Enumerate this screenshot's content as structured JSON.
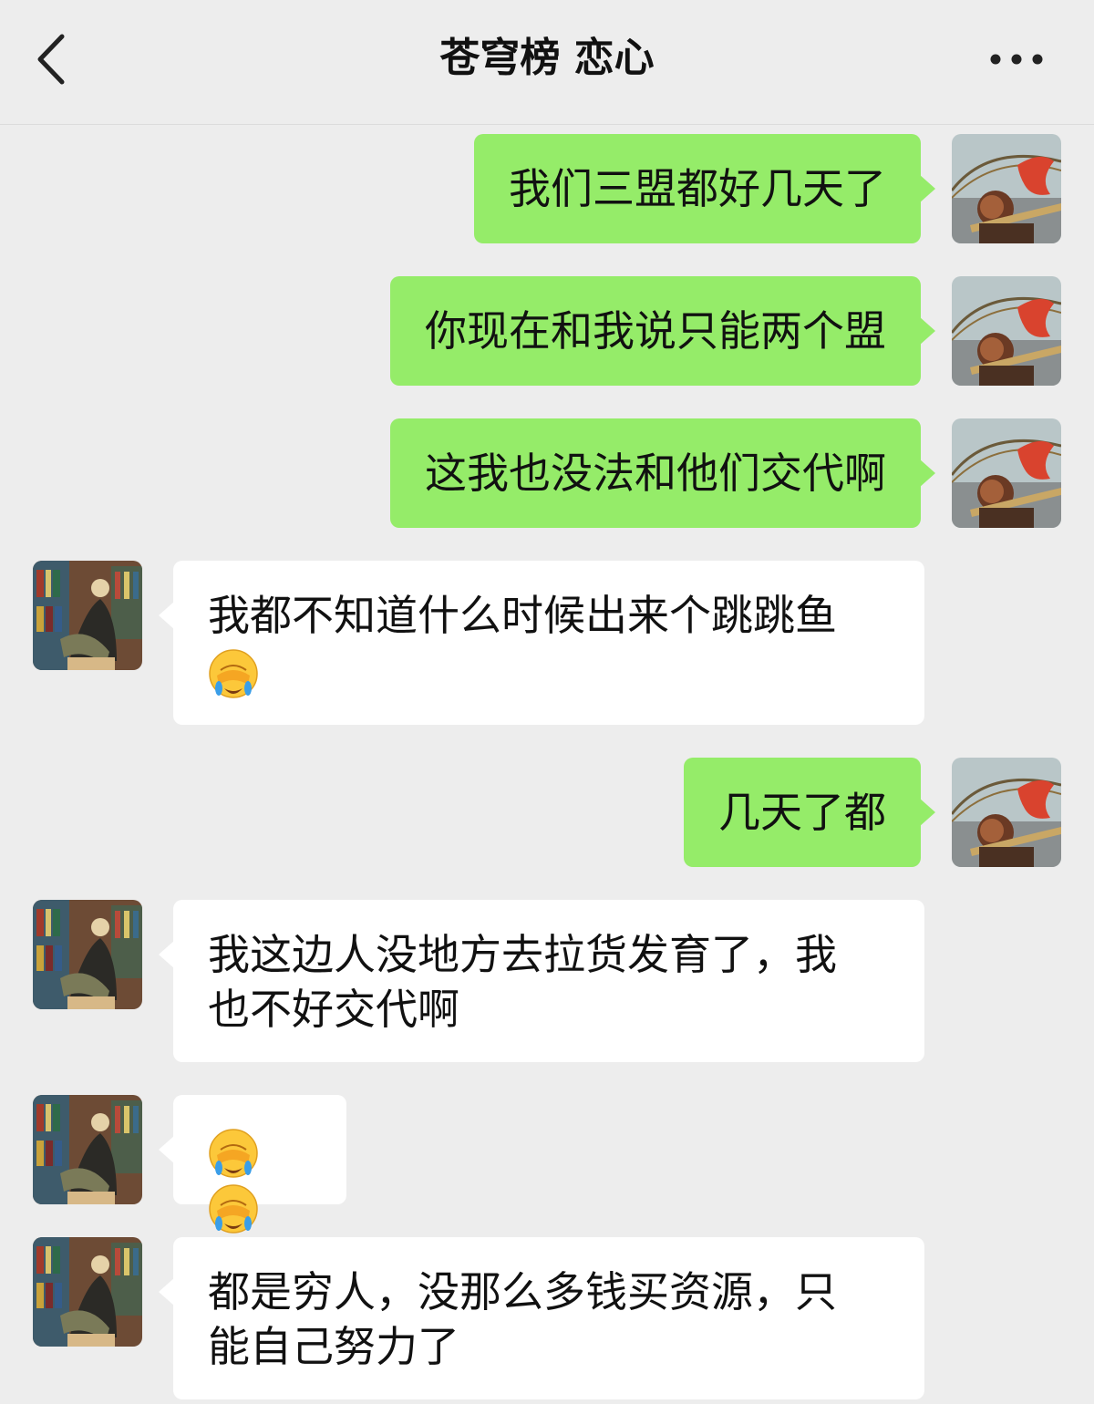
{
  "header": {
    "title": "苍穹榜 恋心",
    "back_icon": "chevron-left-icon",
    "more_icon": "more-dots-icon"
  },
  "colors": {
    "background": "#ededed",
    "my_bubble": "#95ec69",
    "other_bubble": "#ffffff"
  },
  "messages": [
    {
      "sender": "me",
      "text": "我们三盟都好几天了"
    },
    {
      "sender": "me",
      "text": "你现在和我说只能两个盟"
    },
    {
      "sender": "me",
      "text": "这我也没法和他们交代啊"
    },
    {
      "sender": "other",
      "line1": "我都不知道什么时候出来个跳跳鱼",
      "emoji": "face-palm-crying-emoji"
    },
    {
      "sender": "me",
      "text": "几天了都"
    },
    {
      "sender": "other",
      "line1": "我这边人没地方去拉货发育了，我",
      "line2": "也不好交代啊"
    },
    {
      "sender": "other",
      "emoji": "face-palm-crying-emoji"
    },
    {
      "sender": "other",
      "line1": "都是穷人，没那么多钱买资源，只",
      "line2": "能自己努力了"
    }
  ]
}
